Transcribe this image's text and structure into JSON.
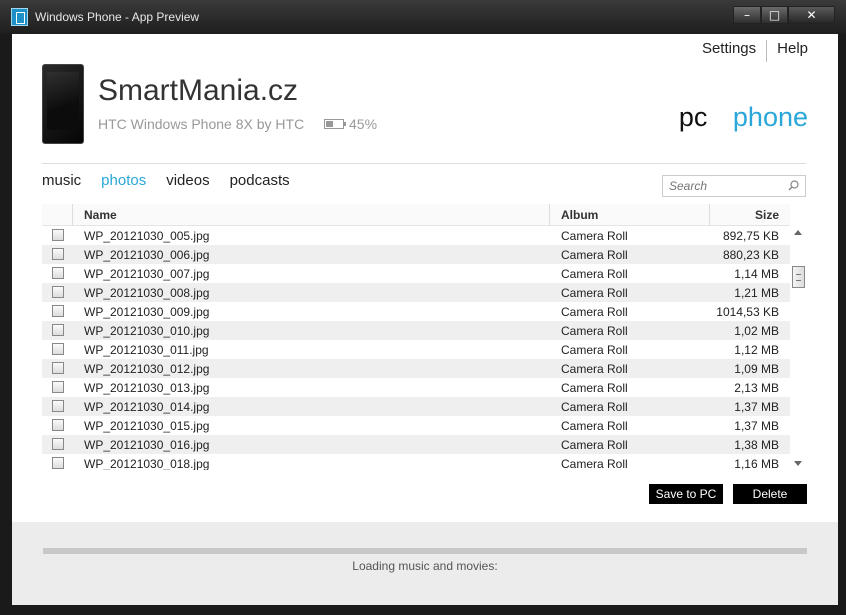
{
  "window": {
    "title": "Windows Phone - App Preview",
    "minimize": "–",
    "maximize": "□",
    "close": "✕"
  },
  "header": {
    "settings": "Settings",
    "help": "Help"
  },
  "device": {
    "name": "SmartMania.cz",
    "model": "HTC Windows Phone 8X by HTC",
    "battery": "45%"
  },
  "view_switch": {
    "pc": "pc",
    "phone": "phone",
    "active": "phone"
  },
  "tabs": [
    {
      "label": "music",
      "active": false
    },
    {
      "label": "photos",
      "active": true
    },
    {
      "label": "videos",
      "active": false
    },
    {
      "label": "podcasts",
      "active": false
    }
  ],
  "search": {
    "placeholder": "Search"
  },
  "table": {
    "columns": {
      "name": "Name",
      "album": "Album",
      "size": "Size"
    },
    "rows": [
      {
        "name": "WP_20121030_005.jpg",
        "album": "Camera Roll",
        "size": "892,75 KB"
      },
      {
        "name": "WP_20121030_006.jpg",
        "album": "Camera Roll",
        "size": "880,23 KB"
      },
      {
        "name": "WP_20121030_007.jpg",
        "album": "Camera Roll",
        "size": "1,14 MB"
      },
      {
        "name": "WP_20121030_008.jpg",
        "album": "Camera Roll",
        "size": "1,21 MB"
      },
      {
        "name": "WP_20121030_009.jpg",
        "album": "Camera Roll",
        "size": "1014,53 KB"
      },
      {
        "name": "WP_20121030_010.jpg",
        "album": "Camera Roll",
        "size": "1,02 MB"
      },
      {
        "name": "WP_20121030_011.jpg",
        "album": "Camera Roll",
        "size": "1,12 MB"
      },
      {
        "name": "WP_20121030_012.jpg",
        "album": "Camera Roll",
        "size": "1,09 MB"
      },
      {
        "name": "WP_20121030_013.jpg",
        "album": "Camera Roll",
        "size": "2,13 MB"
      },
      {
        "name": "WP_20121030_014.jpg",
        "album": "Camera Roll",
        "size": "1,37 MB"
      },
      {
        "name": "WP_20121030_015.jpg",
        "album": "Camera Roll",
        "size": "1,37 MB"
      },
      {
        "name": "WP_20121030_016.jpg",
        "album": "Camera Roll",
        "size": "1,38 MB"
      },
      {
        "name": "WP_20121030_018.jpg",
        "album": "Camera Roll",
        "size": "1,16 MB"
      }
    ]
  },
  "actions": {
    "save_to_pc": "Save to PC",
    "delete": "Delete"
  },
  "footer": {
    "loading_text": "Loading music and movies:",
    "progress": 0
  },
  "colors": {
    "accent": "#2aa7d8",
    "button_bg": "#000000",
    "footer_bg": "#ececec"
  }
}
